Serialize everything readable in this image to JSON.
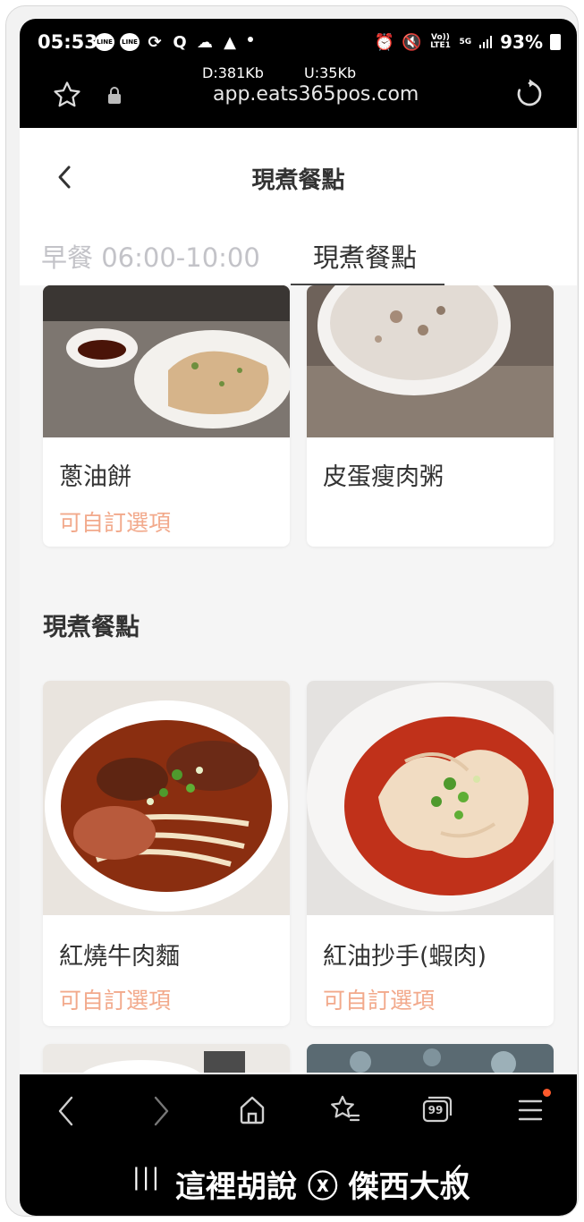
{
  "status_bar": {
    "time": "05:53",
    "left_icons": [
      "line-icon",
      "line-icon",
      "sync-icon",
      "search-q-icon",
      "cloud-icon",
      "image-icon"
    ],
    "right_icons": [
      "alarm-icon",
      "mute-icon",
      "volte-icon",
      "5g-icon",
      "signal-icon"
    ],
    "volte_label": "Vo)) LTE1",
    "network_label": "5G",
    "battery": "93%"
  },
  "browser": {
    "download_speed": "D:381Kb",
    "upload_speed": "U:35Kb",
    "url": "app.eats365pos.com"
  },
  "header": {
    "title": "現煮餐點"
  },
  "tabs": [
    {
      "label": "早餐 06:00-10:00",
      "active": false
    },
    {
      "label": "現煮餐點",
      "active": true
    }
  ],
  "menu_top": [
    {
      "name": "蔥油餅",
      "option": "可自訂選項"
    },
    {
      "name": "皮蛋瘦肉粥",
      "option": ""
    }
  ],
  "section": {
    "title": "現煮餐點"
  },
  "menu_section": [
    {
      "name": "紅燒牛肉麵",
      "option": "可自訂選項"
    },
    {
      "name": "紅油抄手(蝦肉)",
      "option": "可自訂選項"
    }
  ],
  "bottom_nav": [
    "back-arrow-icon",
    "forward-arrow-icon",
    "home-icon",
    "bookmarks-icon",
    "tabs-icon",
    "menu-icon"
  ],
  "tabs_count": "99",
  "watermark": "這裡胡說 ⓧ 傑西大叔",
  "colors": {
    "accent_option": "#f2a98b",
    "tab_inactive": "#c3c3c8",
    "text_dark": "#333333",
    "notification": "#ff5a2c"
  }
}
